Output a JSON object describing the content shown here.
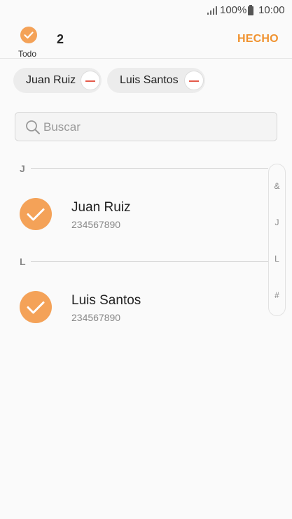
{
  "status_bar": {
    "battery": "100%",
    "time": "10:00",
    "icons": [
      "signal-icon",
      "battery-icon"
    ]
  },
  "header": {
    "select_all_label": "Todo",
    "selected_count": "2",
    "done_label": "HECHO"
  },
  "selected_chips": [
    {
      "label": "Juan Ruiz"
    },
    {
      "label": "Luis Santos"
    }
  ],
  "search": {
    "placeholder": "Buscar"
  },
  "sections": [
    {
      "letter": "J",
      "contacts": [
        {
          "name": "Juan Ruiz",
          "phone": "234567890",
          "selected": true
        }
      ]
    },
    {
      "letter": "L",
      "contacts": [
        {
          "name": "Luis Santos",
          "phone": "234567890",
          "selected": true
        }
      ]
    }
  ],
  "index_scroller": [
    "&",
    "J",
    "L",
    "#"
  ],
  "colors": {
    "accent": "#f0922f",
    "check_fill": "#f4a258",
    "remove_minus": "#e45a4a"
  }
}
